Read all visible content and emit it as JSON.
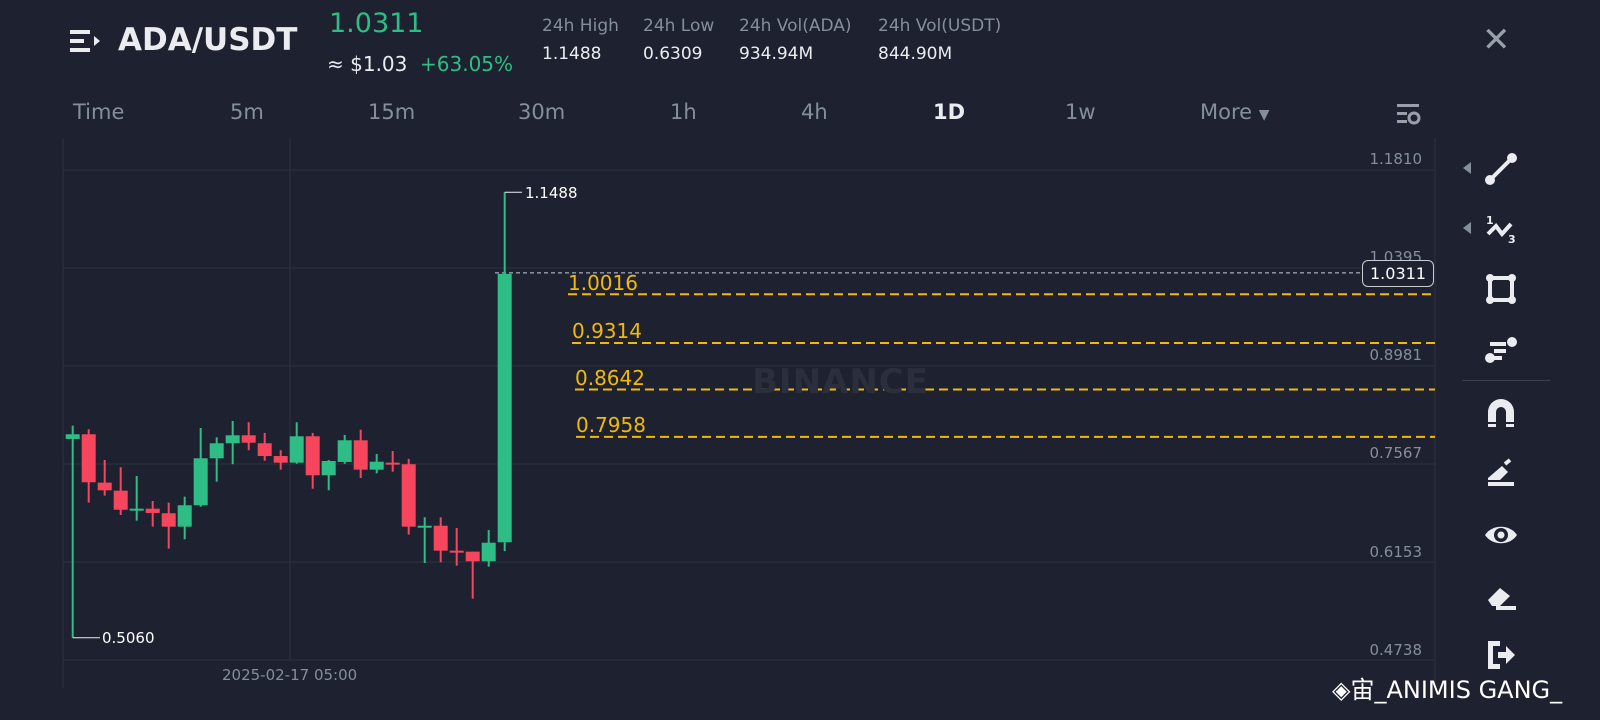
{
  "header": {
    "pair": "ADA/USDT",
    "last_price": "1.0311",
    "usd_price": "≈ $1.03",
    "change": "+63.05%",
    "stats": [
      {
        "label": "24h High",
        "value": "1.1488"
      },
      {
        "label": "24h Low",
        "value": "0.6309"
      },
      {
        "label": "24h Vol(ADA)",
        "value": "934.94M"
      },
      {
        "label": "24h Vol(USDT)",
        "value": "844.90M"
      }
    ]
  },
  "timeframes": [
    "Time",
    "5m",
    "15m",
    "30m",
    "1h",
    "4h",
    "1D",
    "1w",
    "More"
  ],
  "active_timeframe": "1D",
  "colors": {
    "up": "#2ebd85",
    "down": "#f6465d",
    "fib": "#f0b90b",
    "bg": "#1e2230"
  },
  "chart_data": {
    "type": "candlestick",
    "ylim": [
      0.4738,
      1.181
    ],
    "price_ticks": [
      "1.1810",
      "1.0395",
      "0.8981",
      "0.7567",
      "0.6153",
      "0.4738"
    ],
    "x_label": "2025-02-17 05:00",
    "high_marker": "1.1488",
    "low_marker": "0.5060",
    "current_price": "1.0311",
    "fib_levels": [
      "1.0016",
      "0.9314",
      "0.8642",
      "0.7958"
    ],
    "watermark": "BINANCE",
    "candles": [
      [
        0.7928,
        0.812,
        0.506,
        0.7996
      ],
      [
        0.7996,
        0.8068,
        0.7009,
        0.7303
      ],
      [
        0.7298,
        0.7625,
        0.711,
        0.7187
      ],
      [
        0.7182,
        0.752,
        0.6831,
        0.6907
      ],
      [
        0.692,
        0.7394,
        0.6749,
        0.6922
      ],
      [
        0.6922,
        0.7033,
        0.6662,
        0.686
      ],
      [
        0.6856,
        0.7009,
        0.6345,
        0.6662
      ],
      [
        0.6662,
        0.7095,
        0.648,
        0.6971
      ],
      [
        0.6971,
        0.8087,
        0.695,
        0.7649
      ],
      [
        0.7649,
        0.7952,
        0.7312,
        0.7866
      ],
      [
        0.7866,
        0.8188,
        0.7563,
        0.7981
      ],
      [
        0.7981,
        0.8169,
        0.7765,
        0.7874
      ],
      [
        0.7866,
        0.8015,
        0.7615,
        0.7682
      ],
      [
        0.7682,
        0.7765,
        0.7485,
        0.7586
      ],
      [
        0.7586,
        0.8169,
        0.757,
        0.7967
      ],
      [
        0.7967,
        0.8015,
        0.721,
        0.7404
      ],
      [
        0.7404,
        0.7625,
        0.7187,
        0.761
      ],
      [
        0.7596,
        0.7986,
        0.757,
        0.7909
      ],
      [
        0.7909,
        0.8062,
        0.7365,
        0.7485
      ],
      [
        0.7485,
        0.7711,
        0.7433,
        0.76
      ],
      [
        0.7586,
        0.7754,
        0.7456,
        0.758
      ],
      [
        0.7563,
        0.764,
        0.6547,
        0.6662
      ],
      [
        0.6667,
        0.6798,
        0.6138,
        0.6676
      ],
      [
        0.6676,
        0.6798,
        0.6148,
        0.6316
      ],
      [
        0.6316,
        0.6643,
        0.6099,
        0.6302
      ],
      [
        0.6302,
        0.6302,
        0.5623,
        0.6163
      ],
      [
        0.6163,
        0.6614,
        0.6085,
        0.6431
      ],
      [
        0.6437,
        1.1488,
        0.6309,
        1.0311
      ]
    ]
  },
  "toolbar": [
    "trend-line",
    "fib-tool",
    "rectangle",
    "text-tool",
    "magnet",
    "pencil",
    "visibility",
    "eraser",
    "exit"
  ],
  "signature": "宙_ANIMIS GANG_"
}
